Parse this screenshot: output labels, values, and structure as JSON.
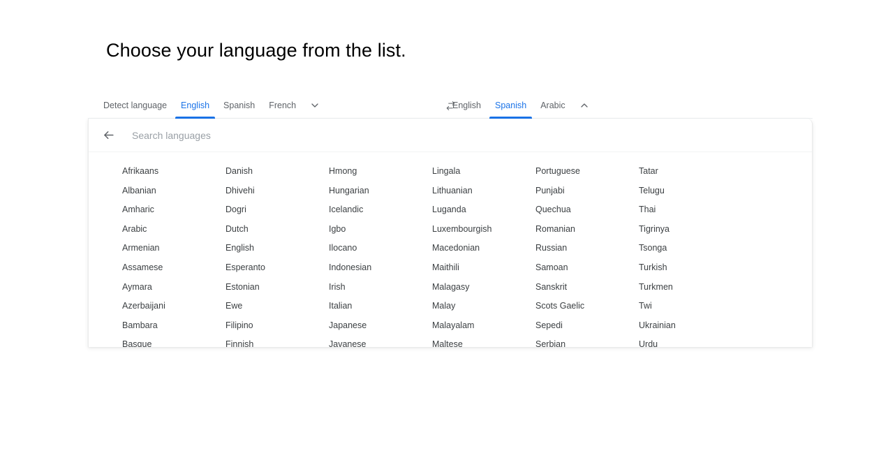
{
  "heading": "Choose your language from the list.",
  "tabs": {
    "source": {
      "items": [
        {
          "label": "Detect language",
          "active": false
        },
        {
          "label": "English",
          "active": true
        },
        {
          "label": "Spanish",
          "active": false
        },
        {
          "label": "French",
          "active": false
        }
      ],
      "expand_icon": "chevron-down-icon"
    },
    "swap_icon": "swap-horizontal-icon",
    "target": {
      "items": [
        {
          "label": "English",
          "active": false
        },
        {
          "label": "Spanish",
          "active": true
        },
        {
          "label": "Arabic",
          "active": false
        }
      ],
      "collapse_icon": "chevron-up-icon"
    }
  },
  "panel": {
    "back_icon": "arrow-left-icon",
    "search": {
      "value": "",
      "placeholder": "Search languages"
    },
    "columns": [
      [
        "Afrikaans",
        "Albanian",
        "Amharic",
        "Arabic",
        "Armenian",
        "Assamese",
        "Aymara",
        "Azerbaijani",
        "Bambara",
        "Basque"
      ],
      [
        "Danish",
        "Dhivehi",
        "Dogri",
        "Dutch",
        "English",
        "Esperanto",
        "Estonian",
        "Ewe",
        "Filipino",
        "Finnish"
      ],
      [
        "Hmong",
        "Hungarian",
        "Icelandic",
        "Igbo",
        "Ilocano",
        "Indonesian",
        "Irish",
        "Italian",
        "Japanese",
        "Javanese"
      ],
      [
        "Lingala",
        "Lithuanian",
        "Luganda",
        "Luxembourgish",
        "Macedonian",
        "Maithili",
        "Malagasy",
        "Malay",
        "Malayalam",
        "Maltese"
      ],
      [
        "Portuguese",
        "Punjabi",
        "Quechua",
        "Romanian",
        "Russian",
        "Samoan",
        "Sanskrit",
        "Scots Gaelic",
        "Sepedi",
        "Serbian"
      ],
      [
        "Tatar",
        "Telugu",
        "Thai",
        "Tigrinya",
        "Tsonga",
        "Turkish",
        "Turkmen",
        "Twi",
        "Ukrainian",
        "Urdu"
      ]
    ]
  },
  "colors": {
    "accent": "#1a73e8",
    "text": "#3c4043",
    "muted": "#5f6368",
    "placeholder": "#9aa0a6",
    "border": "#ebebeb",
    "background": "#ffffff"
  }
}
